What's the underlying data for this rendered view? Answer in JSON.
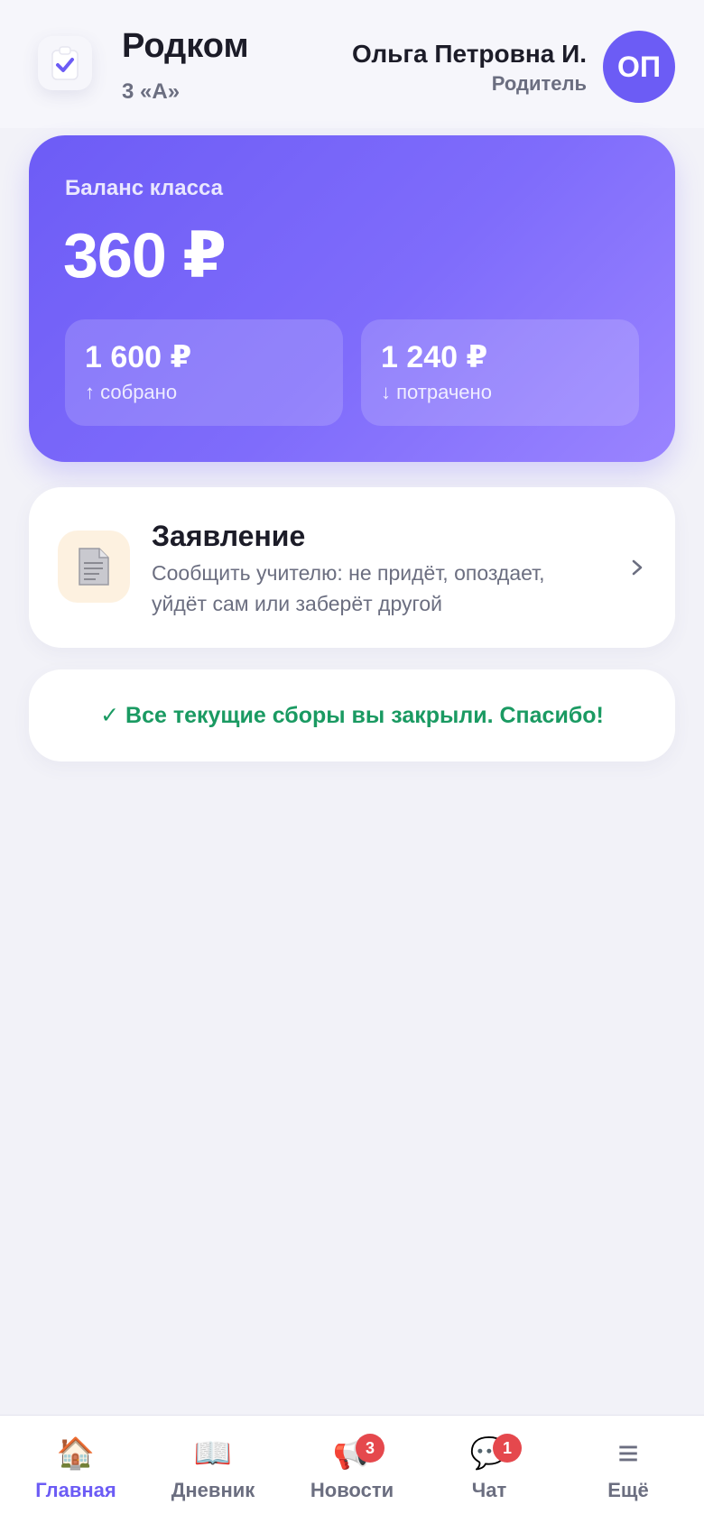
{
  "header": {
    "app_title": "Родком",
    "class_name": "3 «А»",
    "user_name": "Ольга Петровна И.",
    "user_role": "Родитель",
    "avatar_initials": "ОП",
    "app_icon": "clipboard-check-icon"
  },
  "balance": {
    "label": "Баланс класса",
    "amount": "360 ₽",
    "collected": {
      "value": "1 600 ₽",
      "caption": "↑ собрано"
    },
    "spent": {
      "value": "1 240 ₽",
      "caption": "↓ потрачено"
    }
  },
  "statement": {
    "title": "Заявление",
    "description": "Сообщить учителю: не придёт, опоздает, уйдёт сам или заберёт другой",
    "icon": "document-icon"
  },
  "status": {
    "message": "✓ Все текущие сборы вы закрыли. Спасибо!"
  },
  "tabs": [
    {
      "label": "Главная",
      "icon": "🏠",
      "active": true,
      "badge": ""
    },
    {
      "label": "Дневник",
      "icon": "📖",
      "active": false,
      "badge": ""
    },
    {
      "label": "Новости",
      "icon": "📢",
      "active": false,
      "badge": "3"
    },
    {
      "label": "Чат",
      "icon": "💬",
      "active": false,
      "badge": "1"
    },
    {
      "label": "Ещё",
      "icon": "≡",
      "active": false,
      "badge": ""
    }
  ],
  "colors": {
    "accent": "#6c5cf5",
    "success": "#1a9a62",
    "badge": "#e5484d",
    "background": "#f2f2f8"
  }
}
